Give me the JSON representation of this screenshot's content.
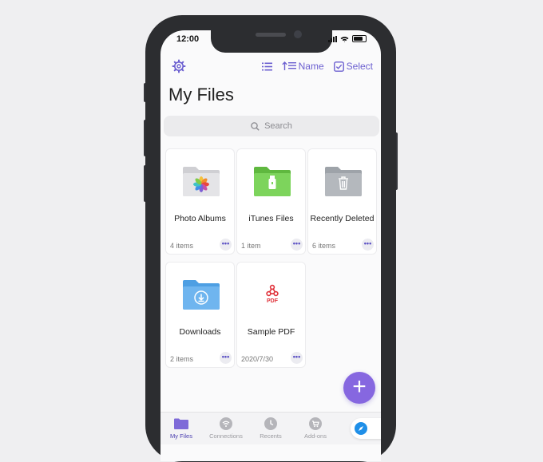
{
  "status": {
    "time": "12:00"
  },
  "toolbar": {
    "sort_label": "Name",
    "select_label": "Select"
  },
  "header": {
    "title": "My Files"
  },
  "search": {
    "placeholder": "Search"
  },
  "files": [
    {
      "name": "Photo Albums",
      "meta": "4 items",
      "icon": "photos-folder-icon"
    },
    {
      "name": "iTunes Files",
      "meta": "1 item",
      "icon": "usb-folder-icon"
    },
    {
      "name": "Recently Deleted",
      "meta": "6 items",
      "icon": "trash-folder-icon"
    },
    {
      "name": "Downloads",
      "meta": "2 items",
      "icon": "download-folder-icon"
    },
    {
      "name": "Sample PDF",
      "meta": "2020/7/30",
      "icon": "pdf-icon",
      "badge": "PDF"
    }
  ],
  "more_label": "•••",
  "fab": {
    "label": "+"
  },
  "tabs": [
    {
      "label": "My Files",
      "icon": "folder-icon",
      "active": true
    },
    {
      "label": "Connections",
      "icon": "wifi-icon"
    },
    {
      "label": "Recents",
      "icon": "clock-icon"
    },
    {
      "label": "Add-ons",
      "icon": "cart-icon"
    }
  ],
  "colors": {
    "accent": "#6b5fd0",
    "fab": "#8667e0",
    "folder_green": "#7dd45c",
    "folder_blue": "#6fb5ef",
    "folder_gray": "#b4b8bd",
    "pdf_red": "#e0323a"
  }
}
